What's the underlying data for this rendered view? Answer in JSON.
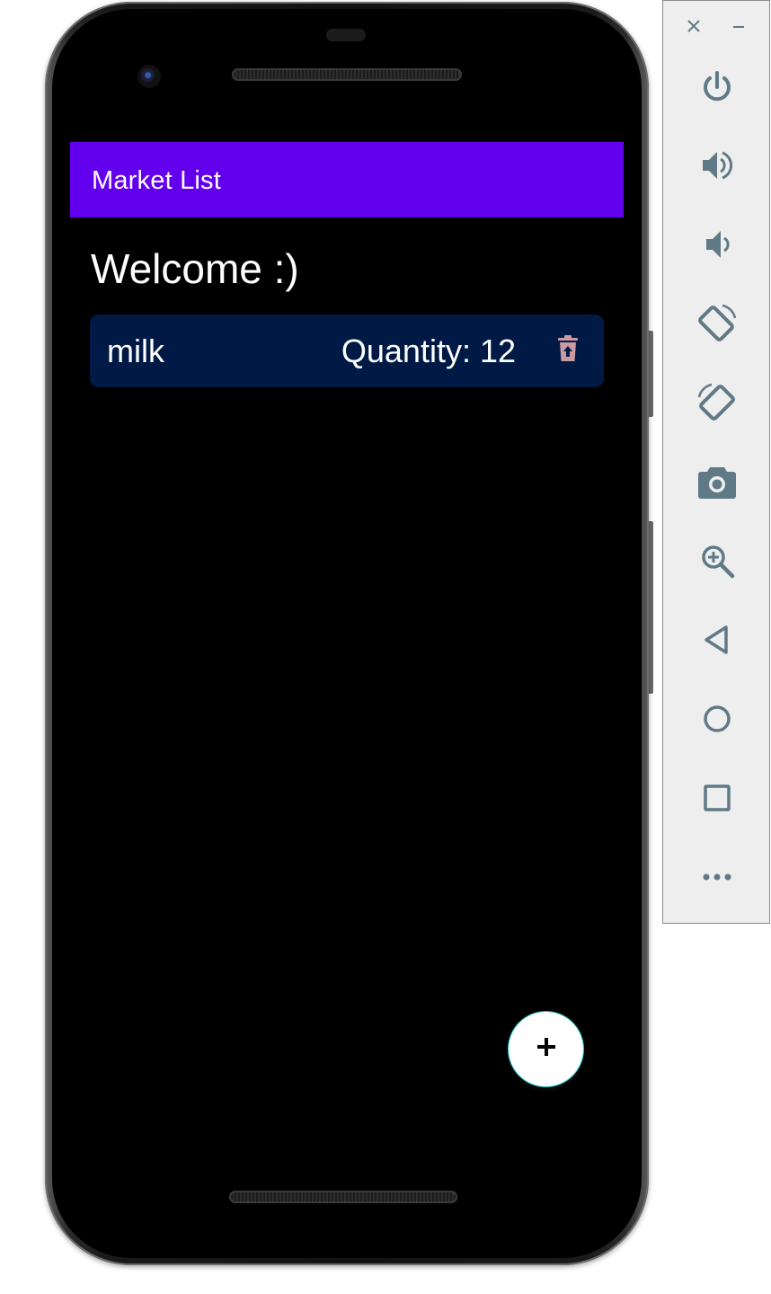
{
  "app": {
    "title": "Market List",
    "welcome": "Welcome :)"
  },
  "items": [
    {
      "name": "milk",
      "quantity_label": "Quantity: 12"
    }
  ],
  "fab": {
    "icon": "plus-icon"
  },
  "colors": {
    "app_bar": "#6200ee",
    "card": "#001a45",
    "delete_icon": "#c99aa4",
    "emulator_icon": "#5f7a86"
  },
  "emulator_toolbar": {
    "window_controls": [
      "close-icon",
      "minimize-icon"
    ],
    "buttons": [
      "power-icon",
      "volume-up-icon",
      "volume-down-icon",
      "rotate-left-icon",
      "rotate-right-icon",
      "camera-icon",
      "zoom-icon",
      "back-icon",
      "home-icon",
      "overview-icon",
      "more-icon"
    ]
  }
}
